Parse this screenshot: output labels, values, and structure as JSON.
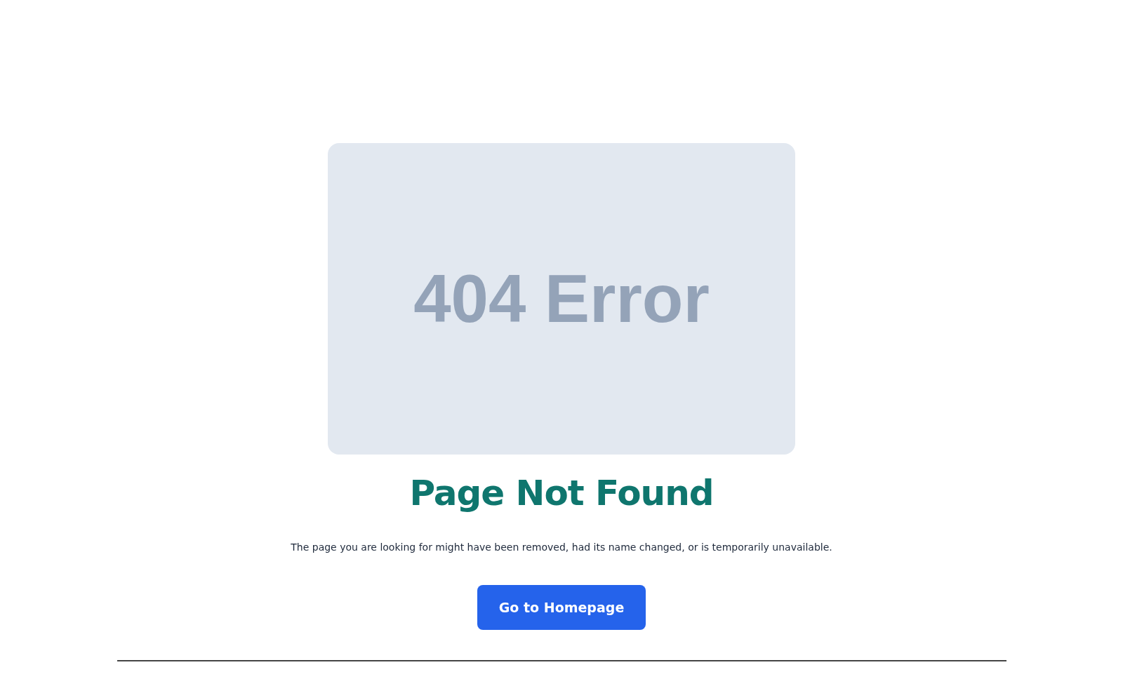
{
  "card": {
    "text": "404 Error"
  },
  "title": "Page Not Found",
  "message": "The page you are looking for might have been removed, had its name changed, or is temporarily unavailable.",
  "button": {
    "label": "Go to Homepage"
  }
}
